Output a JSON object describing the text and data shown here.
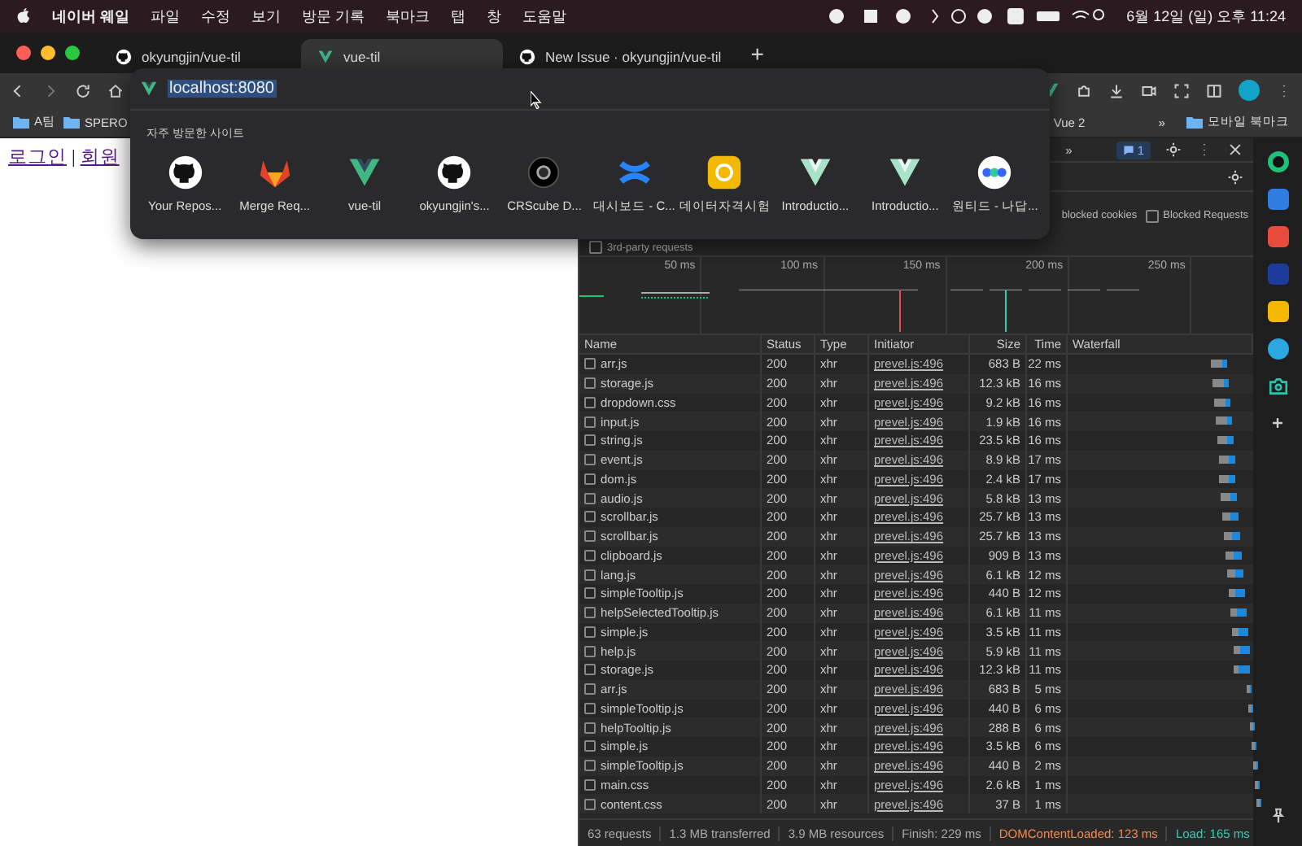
{
  "menu_bar": {
    "app": "네이버 웨일",
    "items": [
      "파일",
      "수정",
      "보기",
      "방문 기록",
      "북마크",
      "탭",
      "창",
      "도움말"
    ],
    "clock": "6월 12일 (일) 오후 11:24"
  },
  "tabs": [
    {
      "label": "okyungjin/vue-til",
      "kind": "github",
      "selected": false
    },
    {
      "label": "vue-til",
      "kind": "vue",
      "selected": true
    },
    {
      "label": "New Issue · okyungjin/vue-til",
      "kind": "github",
      "selected": false
    }
  ],
  "new_tab": "+",
  "bookmarks": {
    "left": [
      "A팀",
      "SPERO"
    ],
    "right_label": "Vue 2",
    "overflow": "»",
    "mobile": "모바일 북마크"
  },
  "page": {
    "links": [
      "로그인",
      "회원"
    ],
    "separator": "|"
  },
  "omnibox": {
    "value": "localhost:8080",
    "section_title": "자주 방문한 사이트",
    "sites": [
      {
        "label": "Your Repos...",
        "kind": "github"
      },
      {
        "label": "Merge Req...",
        "kind": "gitlab"
      },
      {
        "label": "vue-til",
        "kind": "vue"
      },
      {
        "label": "okyungjin's...",
        "kind": "github"
      },
      {
        "label": "CRScube D...",
        "kind": "crscube"
      },
      {
        "label": "대시보드 - C...",
        "kind": "confluence"
      },
      {
        "label": "데이터자격시험",
        "kind": "dataq"
      },
      {
        "label": "Introductio...",
        "kind": "vuelight"
      },
      {
        "label": "Introductio...",
        "kind": "vuelight"
      },
      {
        "label": "원티드 - 나답...",
        "kind": "wanted"
      }
    ]
  },
  "devtools": {
    "overflow": "»",
    "issues_count": "1",
    "blocked_cookies_label": "blocked cookies",
    "blocked_requests": {
      "label": "Blocked Requests",
      "checked": false
    },
    "third_party": {
      "label": "3rd-party requests",
      "checked": false
    },
    "overview_ticks": [
      "50 ms",
      "100 ms",
      "150 ms",
      "200 ms",
      "250 ms"
    ],
    "columns": [
      "Name",
      "Status",
      "Type",
      "Initiator",
      "Size",
      "Time",
      "Waterfall"
    ],
    "rows": [
      [
        "arr.js",
        "200",
        "xhr",
        "prevel.js:496",
        "683 B",
        "22 ms"
      ],
      [
        "storage.js",
        "200",
        "xhr",
        "prevel.js:496",
        "12.3 kB",
        "16 ms"
      ],
      [
        "dropdown.css",
        "200",
        "xhr",
        "prevel.js:496",
        "9.2 kB",
        "16 ms"
      ],
      [
        "input.js",
        "200",
        "xhr",
        "prevel.js:496",
        "1.9 kB",
        "16 ms"
      ],
      [
        "string.js",
        "200",
        "xhr",
        "prevel.js:496",
        "23.5 kB",
        "16 ms"
      ],
      [
        "event.js",
        "200",
        "xhr",
        "prevel.js:496",
        "8.9 kB",
        "17 ms"
      ],
      [
        "dom.js",
        "200",
        "xhr",
        "prevel.js:496",
        "2.4 kB",
        "17 ms"
      ],
      [
        "audio.js",
        "200",
        "xhr",
        "prevel.js:496",
        "5.8 kB",
        "13 ms"
      ],
      [
        "scrollbar.js",
        "200",
        "xhr",
        "prevel.js:496",
        "25.7 kB",
        "13 ms"
      ],
      [
        "scrollbar.js",
        "200",
        "xhr",
        "prevel.js:496",
        "25.7 kB",
        "13 ms"
      ],
      [
        "clipboard.js",
        "200",
        "xhr",
        "prevel.js:496",
        "909 B",
        "13 ms"
      ],
      [
        "lang.js",
        "200",
        "xhr",
        "prevel.js:496",
        "6.1 kB",
        "12 ms"
      ],
      [
        "simpleTooltip.js",
        "200",
        "xhr",
        "prevel.js:496",
        "440 B",
        "12 ms"
      ],
      [
        "helpSelectedTooltip.js",
        "200",
        "xhr",
        "prevel.js:496",
        "6.1 kB",
        "11 ms"
      ],
      [
        "simple.js",
        "200",
        "xhr",
        "prevel.js:496",
        "3.5 kB",
        "11 ms"
      ],
      [
        "help.js",
        "200",
        "xhr",
        "prevel.js:496",
        "5.9 kB",
        "11 ms"
      ],
      [
        "storage.js",
        "200",
        "xhr",
        "prevel.js:496",
        "12.3 kB",
        "11 ms"
      ],
      [
        "arr.js",
        "200",
        "xhr",
        "prevel.js:496",
        "683 B",
        "5 ms"
      ],
      [
        "simpleTooltip.js",
        "200",
        "xhr",
        "prevel.js:496",
        "440 B",
        "6 ms"
      ],
      [
        "helpTooltip.js",
        "200",
        "xhr",
        "prevel.js:496",
        "288 B",
        "6 ms"
      ],
      [
        "simple.js",
        "200",
        "xhr",
        "prevel.js:496",
        "3.5 kB",
        "6 ms"
      ],
      [
        "simpleTooltip.js",
        "200",
        "xhr",
        "prevel.js:496",
        "440 B",
        "2 ms"
      ],
      [
        "main.css",
        "200",
        "xhr",
        "prevel.js:496",
        "2.6 kB",
        "1 ms"
      ],
      [
        "content.css",
        "200",
        "xhr",
        "prevel.js:496",
        "37 B",
        "1 ms"
      ]
    ],
    "status": [
      {
        "text": "63 requests",
        "kind": "plain"
      },
      {
        "text": "1.3 MB transferred",
        "kind": "plain"
      },
      {
        "text": "3.9 MB resources",
        "kind": "plain"
      },
      {
        "text": "Finish: 229 ms",
        "kind": "plain"
      },
      {
        "text": "DOMContentLoaded: 123 ms",
        "kind": "dom"
      },
      {
        "text": "Load: 165 ms",
        "kind": "load"
      }
    ]
  }
}
